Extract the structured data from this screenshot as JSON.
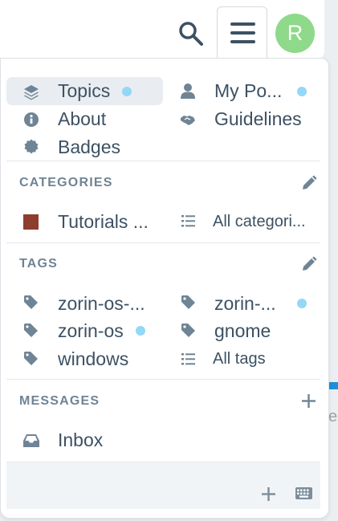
{
  "header": {
    "search_icon": "search-icon",
    "menu_icon": "hamburger-icon",
    "avatar_letter": "R",
    "avatar_color": "#8ed98a"
  },
  "menu": {
    "items": [
      {
        "label": "Topics",
        "icon": "layers-icon",
        "unread": true,
        "active": true
      },
      {
        "label": "My Po...",
        "icon": "user-icon",
        "unread": true
      },
      {
        "label": "About",
        "icon": "info-icon"
      },
      {
        "label": "Guidelines",
        "icon": "handshake-icon"
      },
      {
        "label": "Badges",
        "icon": "badge-icon"
      }
    ]
  },
  "categories": {
    "title": "CATEGORIES",
    "items": [
      {
        "label": "Tutorials ...",
        "color": "#8d3e2d"
      },
      {
        "label": "All categori..."
      }
    ]
  },
  "tags": {
    "title": "TAGS",
    "items": [
      {
        "label": "zorin-os-...",
        "unread": false
      },
      {
        "label": "zorin-...",
        "unread": true
      },
      {
        "label": "zorin-os",
        "unread": true
      },
      {
        "label": "gnome",
        "unread": false
      },
      {
        "label": "windows",
        "unread": false
      },
      {
        "label": "All tags"
      }
    ]
  },
  "messages": {
    "title": "MESSAGES",
    "items": [
      {
        "label": "Inbox",
        "icon": "inbox-icon"
      }
    ]
  },
  "background": {
    "partial_text": "es"
  },
  "colors": {
    "accent_dot": "#94d7f7",
    "text": "#3d5163",
    "section_title": "#6f8494"
  }
}
